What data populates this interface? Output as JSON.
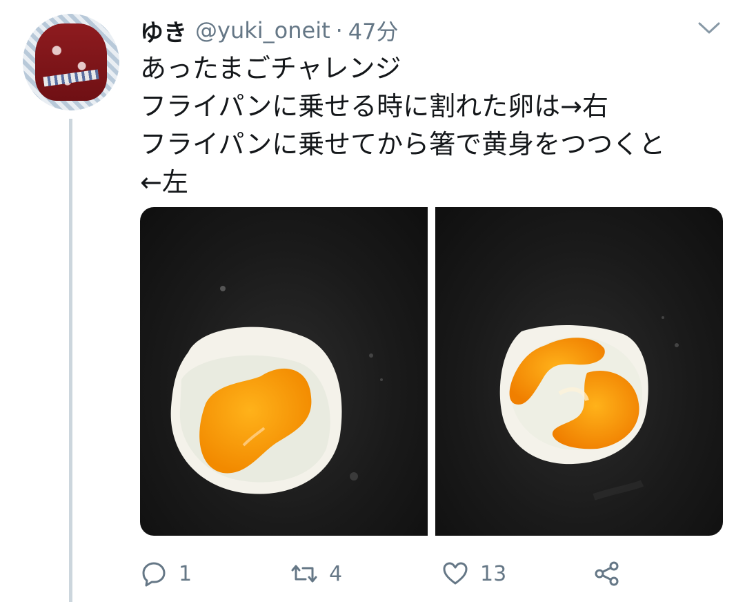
{
  "tweet": {
    "display_name": "ゆき",
    "handle": "@yuki_oneit",
    "separator": "·",
    "time": "47分",
    "text_lines": [
      "あったまごチャレンジ",
      "フライパンに乗せる時に割れた卵は→右",
      "フライパンに乗せてから箸で黄身をつつくと",
      "←左"
    ]
  },
  "icons": {
    "avatar": "avatar-image",
    "more": "chevron-down-icon",
    "reply": "reply-icon",
    "retweet": "retweet-icon",
    "like": "heart-icon",
    "share": "share-icon"
  },
  "actions": {
    "reply_count": "1",
    "retweet_count": "4",
    "like_count": "13"
  },
  "colors": {
    "text": "#14171a",
    "secondary": "#657786",
    "thread_line": "#ccd6dd"
  }
}
